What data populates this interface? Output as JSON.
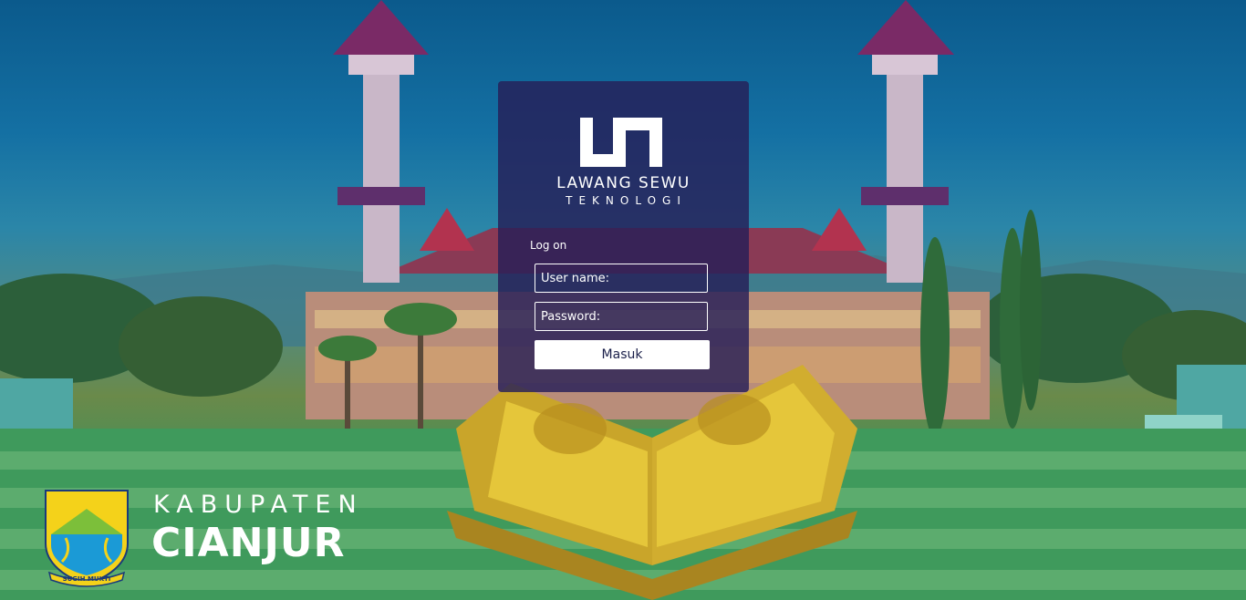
{
  "login": {
    "brand_name": "LAWANG SEWU",
    "brand_sub": "TEKNOLOGI",
    "title": "Log on",
    "username_placeholder": "User name:",
    "password_placeholder": "Password:",
    "submit_label": "Masuk"
  },
  "region": {
    "line1": "KABUPATEN",
    "line2": "CIANJUR",
    "motto": "SUGIH MUKTI"
  },
  "colors": {
    "panel": "#261e58",
    "button_text": "#1a1f4a",
    "emblem_yellow": "#f4d21a",
    "emblem_blue": "#1b9ad6",
    "emblem_green": "#7cbf3a"
  },
  "icons": {
    "brand": "lawang-sewu-logo-icon",
    "emblem": "cianjur-emblem-icon"
  }
}
